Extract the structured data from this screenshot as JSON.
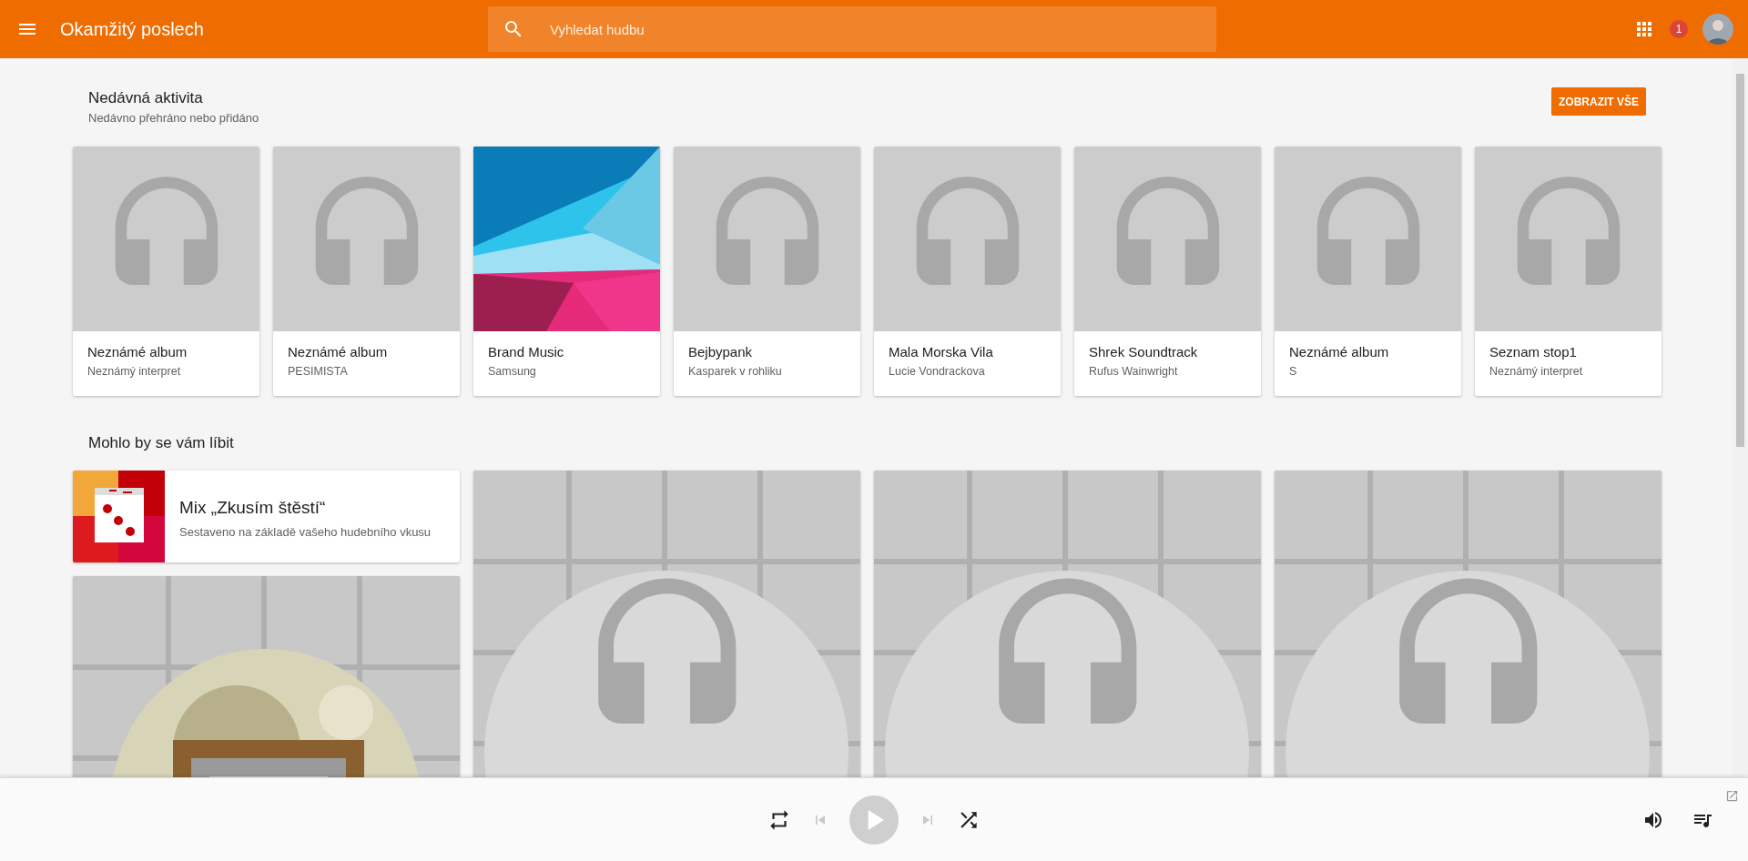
{
  "app_bar": {
    "title": "Okamžitý poslech",
    "search": {
      "placeholder": "Vyhledat hudbu"
    },
    "notifications": "1"
  },
  "recent": {
    "title": "Nedávná aktivita",
    "subtitle": "Nedávno přehráno nebo přidáno",
    "button": "ZOBRAZIT VŠE",
    "items": [
      {
        "title": "Neznámé album",
        "subtitle": "Neznámý interpret",
        "kind": "placeholder"
      },
      {
        "title": "Neznámé album",
        "subtitle": "PESIMISTA",
        "kind": "placeholder"
      },
      {
        "title": "Brand Music",
        "subtitle": "Samsung",
        "kind": "picture"
      },
      {
        "title": "Bejbypank",
        "subtitle": "Kasparek v rohliku",
        "kind": "placeholder"
      },
      {
        "title": "Mala Morska Vila",
        "subtitle": "Lucie Vondrackova",
        "kind": "placeholder"
      },
      {
        "title": "Shrek Soundtrack",
        "subtitle": "Rufus Wainwright",
        "kind": "placeholder"
      },
      {
        "title": "Neznámé album",
        "subtitle": "S",
        "kind": "placeholder"
      },
      {
        "title": "Seznam stop1",
        "subtitle": "Neznámý interpret",
        "kind": "placeholder"
      }
    ]
  },
  "suggestions": {
    "title": "Mohlo by se vám líbit",
    "mix": {
      "title": "Mix „Zkusím štěstí“",
      "subtitle": "Sestaveno na základě vašeho hudebního vkusu"
    },
    "tiles": [
      {
        "kind": "picture"
      },
      {
        "kind": "placeholder"
      },
      {
        "kind": "placeholder"
      },
      {
        "kind": "placeholder"
      }
    ]
  },
  "player": {
    "buttons": [
      {
        "kind": "repeat",
        "disabled": false
      },
      {
        "kind": "previous",
        "disabled": true
      },
      {
        "kind": "play",
        "disabled": true
      },
      {
        "kind": "next",
        "disabled": true
      },
      {
        "kind": "shuffle",
        "disabled": false
      }
    ]
  }
}
